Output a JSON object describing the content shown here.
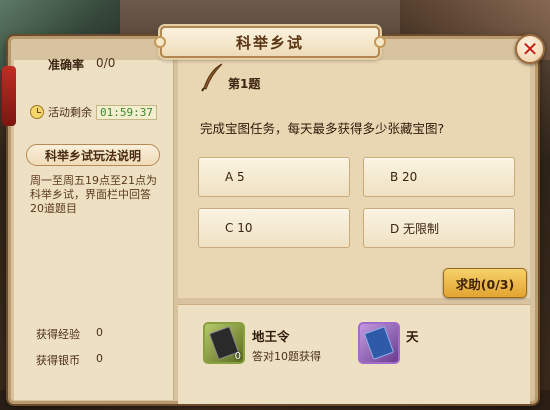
{
  "window": {
    "title": "科举乡试",
    "close_icon": "close-icon"
  },
  "left": {
    "accuracy_label": "准确率",
    "accuracy_value": "0/0",
    "timer_label": "活动剩余",
    "timer_value": "01:59:37",
    "rules_title": "科举乡试玩法说明",
    "rules_text": "周一至周五19点至21点为科举乡试，界面栏中回答20道题目",
    "exp_label": "获得经验",
    "exp_value": "0",
    "silver_label": "获得银币",
    "silver_value": "0"
  },
  "question": {
    "number": "第1题",
    "text": "完成宝图任务，每天最多获得多少张藏宝图?",
    "options": [
      {
        "label": "A  5"
      },
      {
        "label": "B  20"
      },
      {
        "label": "C  10"
      },
      {
        "label": "D  无限制"
      }
    ],
    "help_label": "求助(0/3)"
  },
  "rewards": [
    {
      "name": "地王令",
      "count": "0",
      "desc": "答对10题获得",
      "icon": "token-icon"
    },
    {
      "name": "天",
      "icon": "token-icon"
    }
  ],
  "colors": {
    "accent_red": "#c81d12",
    "timer_green": "#3c8a2c",
    "button_gold": "#e2a432"
  }
}
